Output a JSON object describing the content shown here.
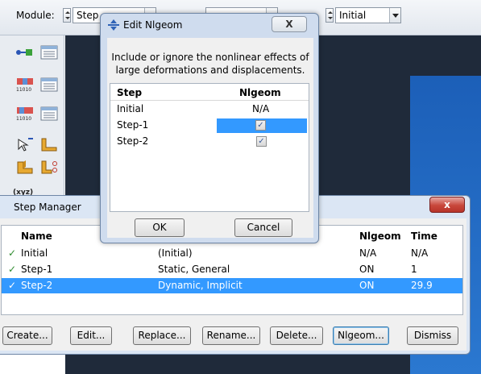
{
  "top_bar": {
    "module_label": "Module:",
    "module_value": "Step",
    "step_value": "Initial"
  },
  "step_manager": {
    "title": "Step Manager",
    "close_label": "x",
    "columns": [
      "Name",
      "",
      "Nlgeom",
      "Time"
    ],
    "rows": [
      {
        "check": "✓",
        "name": "Initial",
        "procedure": "(Initial)",
        "nlgeom": "N/A",
        "time": "N/A"
      },
      {
        "check": "✓",
        "name": "Step-1",
        "procedure": "Static, General",
        "nlgeom": "ON",
        "time": "1"
      },
      {
        "check": "✓",
        "name": "Step-2",
        "procedure": "Dynamic, Implicit",
        "nlgeom": "ON",
        "time": "29.9"
      }
    ],
    "buttons": {
      "create": "Create...",
      "edit": "Edit...",
      "replace": "Replace...",
      "rename": "Rename...",
      "delete": "Delete...",
      "nlgeom": "Nlgeom...",
      "dismiss": "Dismiss"
    }
  },
  "nlgeom_dialog": {
    "title": "Edit Nlgeom",
    "close_label": "X",
    "description_line1": "Include or ignore the nonlinear effects of",
    "description_line2": "large deformations and displacements.",
    "col_step": "Step",
    "col_nlgeom": "Nlgeom",
    "rows": [
      {
        "step": "Initial",
        "value": "N/A"
      },
      {
        "step": "Step-1",
        "value": "✓"
      },
      {
        "step": "Step-2",
        "value": "✓"
      }
    ],
    "ok_label": "OK",
    "cancel_label": "Cancel"
  },
  "toolbox": {
    "tick_label": "(xyz)"
  }
}
